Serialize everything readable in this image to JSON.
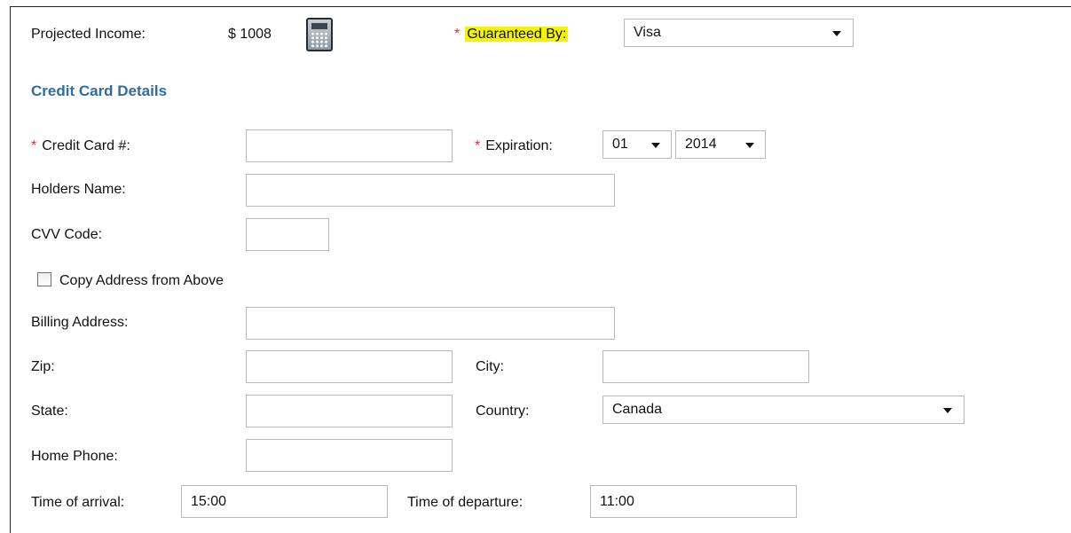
{
  "header": {
    "projected_income_label": "Projected Income:",
    "projected_income_value": "$ 1008",
    "calculator_icon": "calculator-icon",
    "required_mark": "*",
    "guaranteed_by_label": "Guaranteed By:",
    "guaranteed_by_value": "Visa"
  },
  "section": {
    "title": "Credit Card Details"
  },
  "form": {
    "required_mark": "*",
    "credit_card_label": "Credit Card #:",
    "credit_card_value": "",
    "expiration_label": "Expiration:",
    "expiration_month": "01",
    "expiration_year": "2014",
    "holders_name_label": "Holders Name:",
    "holders_name_value": "",
    "cvv_label": "CVV Code:",
    "cvv_value": "",
    "copy_address_label": "Copy Address from Above",
    "copy_address_checked": false,
    "billing_address_label": "Billing Address:",
    "billing_address_value": "",
    "zip_label": "Zip:",
    "zip_value": "",
    "city_label": "City:",
    "city_value": "",
    "state_label": "State:",
    "state_value": "",
    "country_label": "Country:",
    "country_value": "Canada",
    "home_phone_label": "Home Phone:",
    "home_phone_value": "",
    "arrival_label": "Time of arrival:",
    "arrival_value": "15:00",
    "departure_label": "Time of departure:",
    "departure_value": "11:00"
  },
  "colors": {
    "section_title": "#2f6c9f",
    "required_mark": "#e03030",
    "highlight": "#f4f400",
    "input_border": "#b9b9b9"
  }
}
